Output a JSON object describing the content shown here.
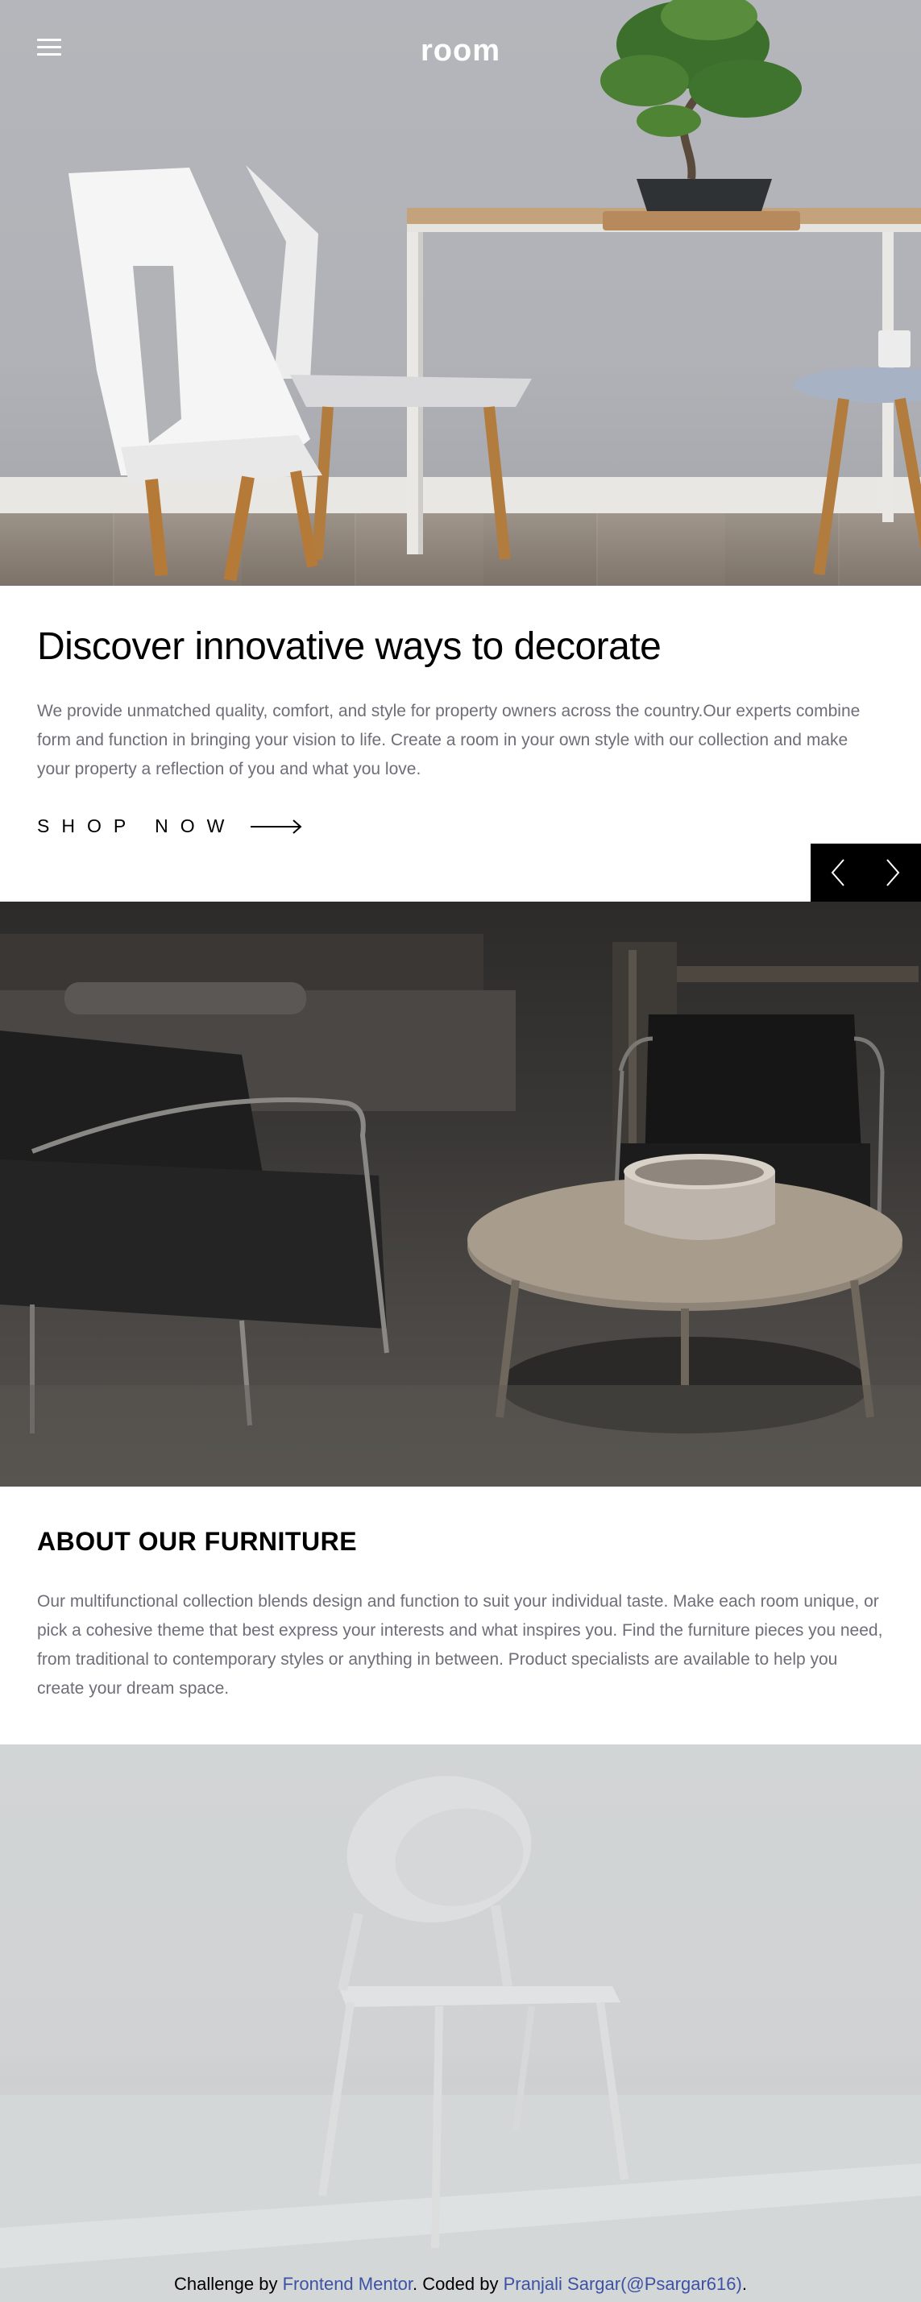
{
  "header": {
    "menu_icon": "hamburger-menu-icon",
    "logo": "room"
  },
  "hero": {
    "title": "Discover innovative ways to decorate",
    "description": "We provide unmatched quality, comfort, and style for property owners across the country.Our experts combine form and function in bringing your vision to life. Create a room in your own style with our collection and make your property a reflection of you and what you love.",
    "cta_label": "SHOP NOW",
    "cta_icon": "arrow-right-icon"
  },
  "slider": {
    "prev_icon": "chevron-left-icon",
    "next_icon": "chevron-right-icon"
  },
  "about": {
    "title": "ABOUT OUR FURNITURE",
    "description": "Our multifunctional collection blends design and function to suit your individual taste. Make each room unique, or pick a cohesive theme that best express your interests and what inspires you. Find the furniture pieces you need, from traditional to contemporary styles or anything in between. Product specialists are available to help you create your dream space."
  },
  "footer": {
    "prefix": "Challenge by",
    "link1": "Frontend Mentor",
    "middle": ". Coded by",
    "link2": "Pranjali Sargar(@Psargar616)",
    "suffix": "."
  },
  "colors": {
    "text_muted": "#6e6e78",
    "link": "#3e52a3",
    "slider_bg": "#000000"
  }
}
